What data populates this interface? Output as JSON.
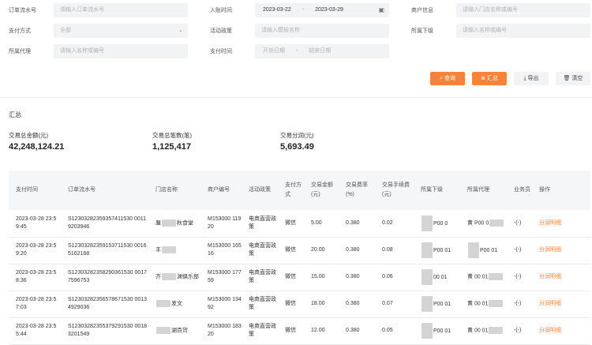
{
  "filters": {
    "order_no": {
      "label": "订单流水号",
      "placeholder": "请输入订单流水号"
    },
    "entry_time": {
      "label": "入账时间",
      "start": "2023-03-22",
      "sep": "-",
      "end": "2023-03-29"
    },
    "merchant_info": {
      "label": "商户信息",
      "placeholder": "请输入门店名称或编号"
    },
    "pay_method": {
      "label": "支付方式",
      "value": "全部"
    },
    "activity_policy": {
      "label": "活动政策",
      "placeholder": "请输入模板名称"
    },
    "belong_sub": {
      "label": "所属下级",
      "placeholder": "请输入名称或编号"
    },
    "belong_agent": {
      "label": "所属代理",
      "placeholder": "请输入名称或编号"
    },
    "pay_time": {
      "label": "支付时间",
      "start_placeholder": "开始日期",
      "sep": "-",
      "end_placeholder": "结束日期"
    }
  },
  "buttons": {
    "query": "查询",
    "summary": "汇总",
    "export": "导出",
    "clear": "清空"
  },
  "summary": {
    "title": "汇总",
    "stats": [
      {
        "label": "交易总金额(元)",
        "value": "42,248,124.21"
      },
      {
        "label": "交易总笔数(笔)",
        "value": "1,125,417"
      },
      {
        "label": "交易分润(元)",
        "value": "5,693.49"
      }
    ]
  },
  "table": {
    "headers": [
      "支付时间",
      "订单流水号",
      "门店名称",
      "商户编号",
      "活动政策",
      "支付方式",
      "交易金额(元)",
      "交易费率(%)",
      "交易手续费(元)",
      "所属下级",
      "所属代理",
      "业务员",
      "操作"
    ],
    "rows": [
      {
        "time": "2023-03-28 23:59:45",
        "order": "S12303282359357411530 00119203946",
        "store_a": "厘",
        "store_b": "秋食堂",
        "mch": "M153000 11920",
        "policy": "电商直营政策",
        "pay": "微信",
        "amount": "5.00",
        "rate": "0.380",
        "fee": "0.02",
        "sub": "P00 0",
        "agent": "黄 P00 0",
        "sales": "-(-)",
        "op": "分润明细"
      },
      {
        "time": "2023-03-28 23:59:20",
        "order": "S12303282359153711530 00165162168",
        "store_a": "丰",
        "store_b": "",
        "mch": "M153000 16516",
        "policy": "电商直营政策",
        "pay": "微信",
        "amount": "20.00",
        "rate": "0.380",
        "fee": "0.08",
        "sub": "P00 01",
        "agent": "P00 01",
        "sales": "-(-)",
        "op": "分润明细"
      },
      {
        "time": "2023-03-28 23:58:36",
        "order": "S12303282358290361530 00177596753",
        "store_a": "齐",
        "store_b": "渊俱乐部",
        "mch": "M153000 17759",
        "policy": "电商直营政策",
        "pay": "微信",
        "amount": "15.00",
        "rate": "0.380",
        "fee": "0.06",
        "sub": "00 01",
        "agent": "黄 00 01",
        "sales": "-(-)",
        "op": "分润明细"
      },
      {
        "time": "2023-03-28 23:57:03",
        "order": "S12303282356578671530 00134929036",
        "store_a": "",
        "store_b": "发文",
        "mch": "M153000 13492",
        "policy": "电商直营政策",
        "pay": "微信",
        "amount": "18.00",
        "rate": "0.380",
        "fee": "0.07",
        "sub": "P00 01",
        "agent": "黄 00 01",
        "sales": "-(-)",
        "op": "分润明细"
      },
      {
        "time": "2023-03-28 23:55:44",
        "order": "S12303282355379291530 00183201549",
        "store_a": "",
        "store_b": "湖百货",
        "mch": "M153000 18320",
        "policy": "电商直营政策",
        "pay": "微信",
        "amount": "12.00",
        "rate": "0.380",
        "fee": "0.05",
        "sub": "P00 01",
        "agent": "黄 00 01",
        "sales": "-(-)",
        "op": "分润明细"
      }
    ]
  },
  "colors": {
    "accent": "#f5843a",
    "input_bg": "#f2f3f5",
    "header_bg": "#f5f6f8"
  },
  "icons": {
    "query": "search-icon",
    "summary": "summary-icon",
    "export": "download-icon",
    "clear": "trash-icon",
    "calendar": "calendar-icon",
    "dropdown": "chevron-down-icon"
  }
}
